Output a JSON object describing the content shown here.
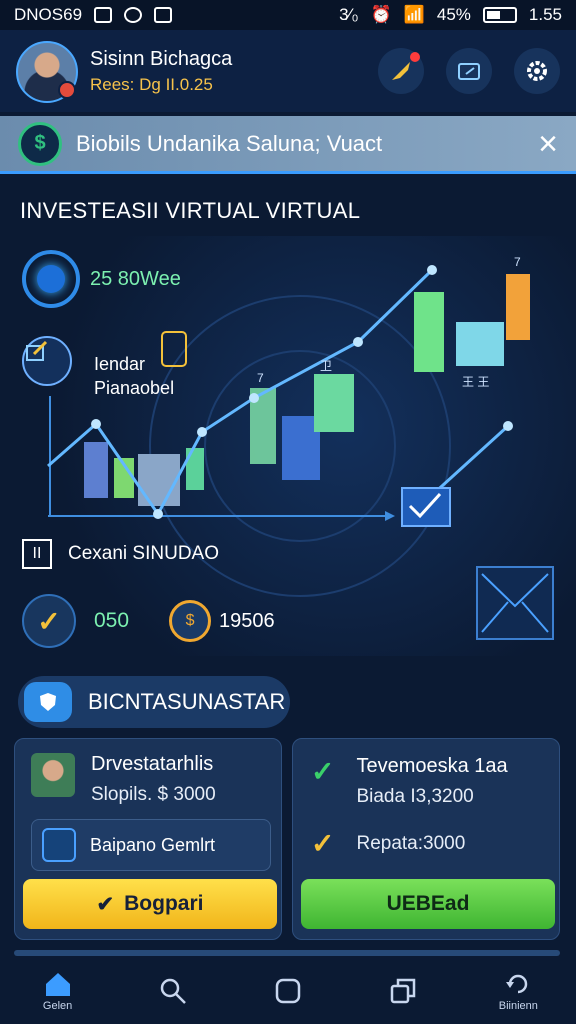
{
  "status_bar": {
    "left_text": "DNOS69",
    "battery": "45%",
    "time": "1.55",
    "signal_text": "3⁄₀"
  },
  "header": {
    "user_name": "Sisinn Bichagca",
    "user_sub": "Rees: Dg II.0.25"
  },
  "banner": {
    "text": "Biobils Undanika Saluna; Vuact",
    "close": "×",
    "icon": "$"
  },
  "section_title": "INVESTEASII VIRTUAL VIRTUAL",
  "dashboard": {
    "metric_value": "25 80Wee",
    "note_line1": "Iendar",
    "note_line2": "Pianaobel",
    "stat_label": "Cexani SINUDAO",
    "stat_icon": "II",
    "score_value": "050",
    "coin_value": "19506",
    "chart_markers": [
      "7",
      "卫",
      "王 王",
      "7"
    ]
  },
  "pill": {
    "label": "BICNTASUNASTAR"
  },
  "cards": {
    "left": {
      "title": "Drvestatarhlis",
      "sub": "Slopils. $ 3000",
      "inner_label": "Baipano Gemlrt",
      "button": "Bogpari"
    },
    "right": {
      "title": "Tevemoeska 1aa",
      "sub": "Biada I3,3200",
      "row2": "Repata:3000",
      "button": "UEBEad"
    }
  },
  "nav": {
    "items": [
      {
        "label": "Gelen",
        "icon": "home-icon"
      },
      {
        "label": "",
        "icon": "search-icon"
      },
      {
        "label": "",
        "icon": "square-icon"
      },
      {
        "label": "",
        "icon": "copy-icon"
      },
      {
        "label": "Biinienn",
        "icon": "refresh-icon"
      }
    ]
  }
}
